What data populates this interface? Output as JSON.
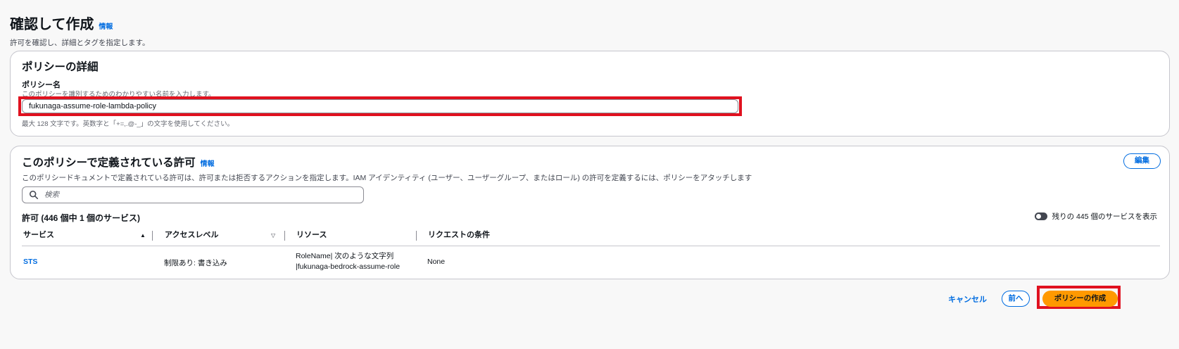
{
  "header": {
    "title": "確認して作成",
    "info_link": "情報",
    "subtitle": "許可を確認し、詳細とタグを指定します。"
  },
  "policy_details": {
    "title": "ポリシーの詳細",
    "name_label": "ポリシー名",
    "name_description": "このポリシーを識別するためのわかりやすい名前を入力します。",
    "name_value": "fukunaga-assume-role-lambda-policy",
    "name_hint": "最大 128 文字です。英数字と「+=,.@-_」の文字を使用してください。"
  },
  "permissions": {
    "title": "このポリシーで定義されている許可",
    "info_link": "情報",
    "edit_label": "編集",
    "description": "このポリシードキュメントで定義されている許可は、許可または拒否するアクションを指定します。IAM アイデンティティ (ユーザー、ユーザーグループ、またはロール) の許可を定義するには、ポリシーをアタッチします",
    "search_placeholder": "検索",
    "count_label": "許可 (446 個中 1 個のサービス)",
    "toggle_label": "残りの 445 個のサービスを表示",
    "toggle_on": false,
    "columns": {
      "service": "サービス",
      "access_level": "アクセスレベル",
      "resource": "リソース",
      "conditions": "リクエストの条件"
    },
    "rows": [
      {
        "service": "STS",
        "access_level": "制限あり: 書き込み",
        "resource_line1": "RoleName| 次のような文字列",
        "resource_line2": "|fukunaga-bedrock-assume-role",
        "conditions": "None"
      }
    ]
  },
  "footer": {
    "cancel_label": "キャンセル",
    "previous_label": "前へ",
    "create_label": "ポリシーの作成"
  },
  "colors": {
    "link": "#006ce0",
    "primary_button": "#ff9900",
    "highlight": "#e0111f"
  }
}
